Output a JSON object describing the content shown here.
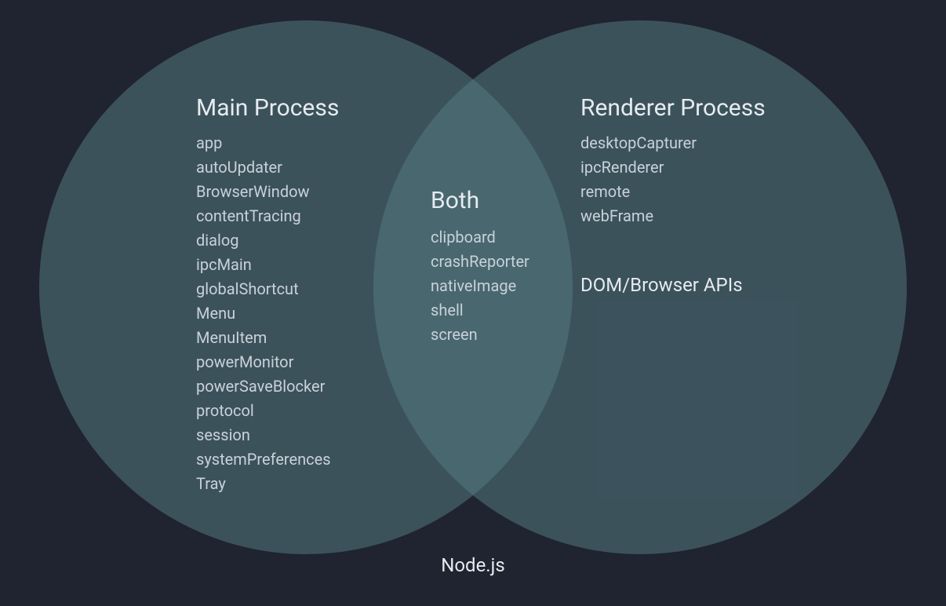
{
  "venn": {
    "main": {
      "title": "Main Process",
      "items": [
        "app",
        "autoUpdater",
        "BrowserWindow",
        "contentTracing",
        "dialog",
        "ipcMain",
        "globalShortcut",
        "Menu",
        "MenuItem",
        "powerMonitor",
        "powerSaveBlocker",
        "protocol",
        "session",
        "systemPreferences",
        "Tray"
      ]
    },
    "both": {
      "title": "Both",
      "items": [
        "clipboard",
        "crashReporter",
        "nativeImage",
        "shell",
        "screen"
      ]
    },
    "renderer": {
      "title": "Renderer Process",
      "items": [
        "desktopCapturer",
        "ipcRenderer",
        "remote",
        "webFrame"
      ],
      "extra": "DOM/Browser APIs"
    },
    "footer": "Node.js"
  }
}
